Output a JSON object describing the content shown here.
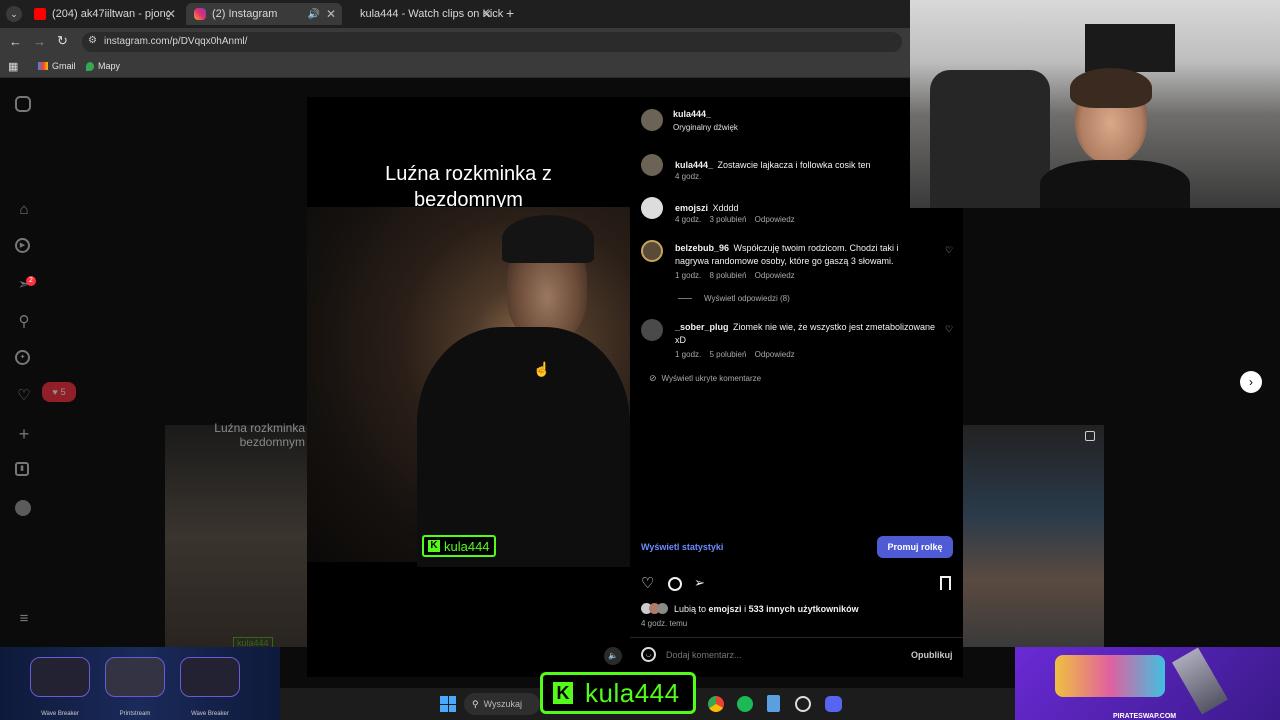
{
  "browser": {
    "tabs": [
      {
        "label": "(204) ak47iiltwan - pjongjang -"
      },
      {
        "label": "(2) Instagram"
      },
      {
        "label": "kula444 - Watch clips on Kick"
      }
    ],
    "url": "instagram.com/p/DVqqx0hAnml/",
    "bookmarks": [
      {
        "label": "Gmail"
      },
      {
        "label": "Mapy"
      }
    ]
  },
  "sidebar": {
    "notifications_badge": "2",
    "likes_popup_count": "5"
  },
  "video": {
    "caption": "Luźna rozkminka z bezdomnym",
    "watermark": "kula444"
  },
  "left_preview": {
    "caption": "Luźna rozkminka bezdomnym",
    "watermark": "kula444"
  },
  "post": {
    "author": "kula444_",
    "audio": "Oryginalny dźwięk",
    "comments": [
      {
        "user": "kula444_",
        "text": "Zostawcie lajkacza i followka cosik ten",
        "time": "4 godz.",
        "likes": "",
        "reply": ""
      },
      {
        "user": "emojszi",
        "text": "Xdddd",
        "time": "4 godz.",
        "likes": "3 polubień",
        "reply": "Odpowiedz"
      },
      {
        "user": "belzebub_96",
        "text": "Współczuję twoim rodzicom. Chodzi taki i nagrywa randomowe osoby, które go gaszą 3 słowami.",
        "time": "1 godz.",
        "likes": "8 polubień",
        "reply": "Odpowiedz"
      },
      {
        "user": "_sober_plug",
        "text": "Ziomek nie wie, że wszystko jest zmetabolizowane xD",
        "time": "1 godz.",
        "likes": "5 polubień",
        "reply": "Odpowiedz"
      }
    ],
    "view_replies": "Wyświetl odpowiedzi (8)",
    "hidden_comments": "Wyświetl ukryte komentarze",
    "stats_link": "Wyświetl statystyki",
    "promote_button": "Promuj rolkę",
    "likes_prefix": "Lubią to",
    "likes_user": "emojszi",
    "likes_mid": "i",
    "likes_others": "533 innych użytkowników",
    "posted": "4 godz. temu",
    "comment_placeholder": "Dodaj komentarz...",
    "publish_button": "Opublikuj"
  },
  "bottom_banner": {
    "skins": [
      "Wave Breaker",
      "Printstream",
      "Wave Breaker"
    ],
    "site": "PIRATESWAP.COM"
  },
  "taskbar": {
    "search_placeholder": "Wyszukaj"
  },
  "kick_overlay": {
    "channel": "kula444"
  },
  "colors": {
    "kick_green": "#53fc18",
    "instagram_blue": "#4f5bd5",
    "link_blue": "#6a8cff"
  }
}
